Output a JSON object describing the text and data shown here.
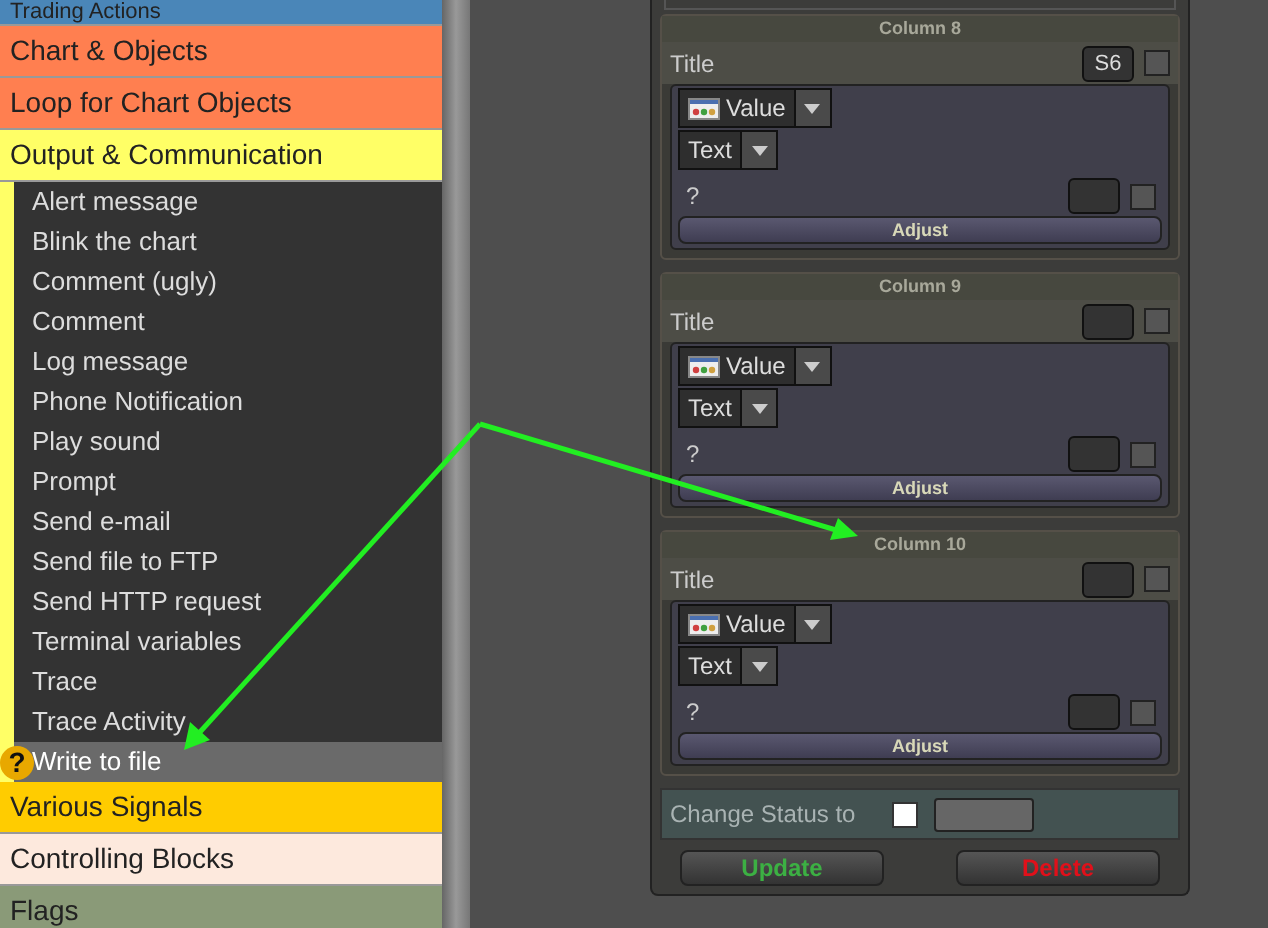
{
  "sidebar": {
    "categories": [
      {
        "label": "Trading Actions",
        "color": "#4a86b8"
      },
      {
        "label": "Chart & Objects",
        "color": "#ff7f50"
      },
      {
        "label": "Loop for Chart Objects",
        "color": "#ff7f50"
      },
      {
        "label": "Output & Communication",
        "color": "#ffff66",
        "items": [
          {
            "label": "Alert message",
            "selected": false
          },
          {
            "label": "Blink the chart",
            "selected": false
          },
          {
            "label": "Comment (ugly)",
            "selected": false
          },
          {
            "label": "Comment",
            "selected": false
          },
          {
            "label": "Log message",
            "selected": false
          },
          {
            "label": "Phone Notification",
            "selected": false
          },
          {
            "label": "Play sound",
            "selected": false
          },
          {
            "label": "Prompt",
            "selected": false
          },
          {
            "label": "Send e-mail",
            "selected": false
          },
          {
            "label": "Send file to FTP",
            "selected": false
          },
          {
            "label": "Send HTTP request",
            "selected": false
          },
          {
            "label": "Terminal variables",
            "selected": false
          },
          {
            "label": "Trace",
            "selected": false
          },
          {
            "label": "Trace Activity",
            "selected": false
          },
          {
            "label": "Write to file",
            "selected": true,
            "help": "?"
          }
        ]
      },
      {
        "label": "Various Signals",
        "color": "#ffcc00"
      },
      {
        "label": "Controlling Blocks",
        "color": "#fde9dd"
      },
      {
        "label": "Flags",
        "color": "#8a9a78"
      }
    ]
  },
  "columns": [
    {
      "header": "Column 8",
      "title": "Title",
      "title_value": "S6",
      "title_checked": false,
      "source": "Value",
      "format": "Text",
      "question": "?",
      "question_checked": false,
      "button": "Adjust"
    },
    {
      "header": "Column 9",
      "title": "Title",
      "title_checked": false,
      "source": "Value",
      "format": "Text",
      "question": "?",
      "question_checked": false,
      "button": "Adjust"
    },
    {
      "header": "Column 10",
      "title": "Title",
      "title_checked": false,
      "source": "Value",
      "format": "Text",
      "question": "?",
      "question_checked": false,
      "button": "Adjust"
    }
  ],
  "change_status": {
    "label": "Change Status to",
    "checked": false
  },
  "buttons": [
    {
      "label": "Update",
      "color": "#3cb043"
    },
    {
      "label": "Delete",
      "color": "#e0101a"
    }
  ]
}
